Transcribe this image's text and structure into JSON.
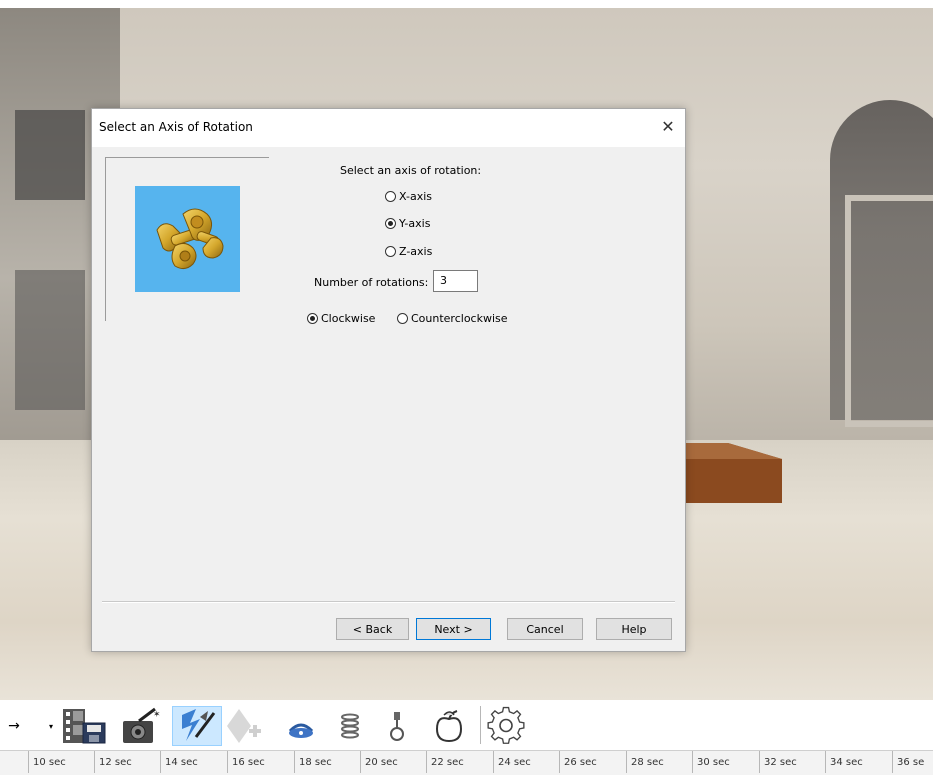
{
  "dialog": {
    "title": "Select an Axis of Rotation",
    "close_glyph": "✕",
    "prompt": "Select an axis of rotation:",
    "axes": [
      {
        "label": "X-axis",
        "selected": false
      },
      {
        "label": "Y-axis",
        "selected": true
      },
      {
        "label": "Z-axis",
        "selected": false
      }
    ],
    "rotations_label": "Number of rotations:",
    "rotations_value": "3",
    "directions": [
      {
        "label": "Clockwise",
        "selected": true
      },
      {
        "label": "Counterclockwise",
        "selected": false
      }
    ],
    "buttons": {
      "back": "< Back",
      "next": "Next >",
      "cancel": "Cancel",
      "help": "Help"
    },
    "preview_bg_color": "#56b4ee",
    "part_color": "#d4a72c"
  },
  "toolbar": {
    "icons": [
      "arrow-right-icon",
      "dropdown-arrow-icon",
      "film-save-icon",
      "camera-wand-icon",
      "lightning-wand-icon",
      "add-keyframe-icon",
      "rotate-part-icon",
      "spring-icon",
      "hook-icon",
      "gravity-apple-icon",
      "gear-icon"
    ]
  },
  "timeline": {
    "ticks": [
      "10 sec",
      "12 sec",
      "14 sec",
      "16 sec",
      "18 sec",
      "20 sec",
      "22 sec",
      "24 sec",
      "26 sec",
      "28 sec",
      "30 sec",
      "32 sec",
      "34 sec",
      "36 se"
    ]
  }
}
